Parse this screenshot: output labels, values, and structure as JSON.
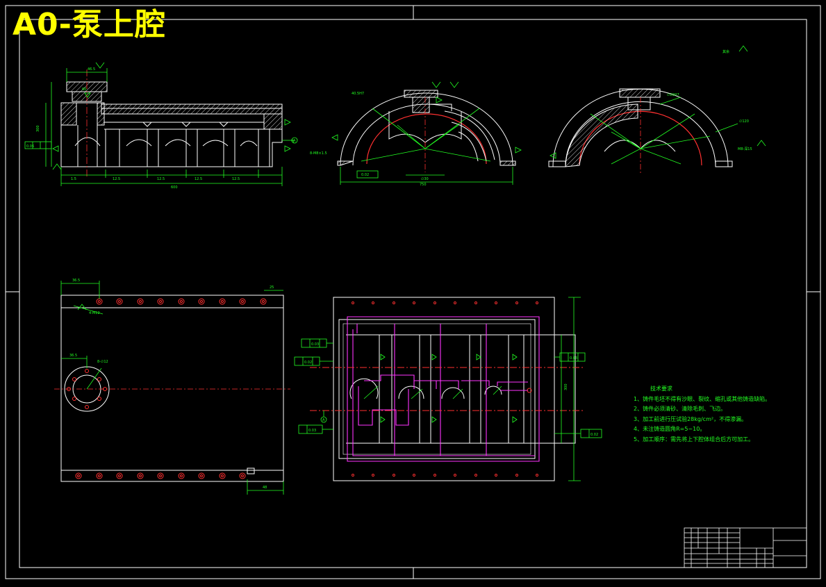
{
  "drawing": {
    "title": "A0-泵上腔",
    "colors": {
      "background": "#000000",
      "outline": "#ffffff",
      "dimension": "#22ff22",
      "centerline": "#ff3030",
      "hatch": "#ffffff",
      "pipe": "#ff33ff",
      "title_text": "#ffff00"
    }
  },
  "technical_requirements": {
    "heading": "技术要求",
    "items": [
      "1、铸件毛坯不得有沙眼、裂纹、缩孔或其他铸造缺陷。",
      "2、铸件必须清砂、清除毛刺、飞边。",
      "3、加工前进行压试验28kg/cm²，不得渗漏。",
      "4、未注铸造圆角R=5~10。",
      "5、加工顺序：需先将上下腔体组合后方可加工。"
    ]
  },
  "datum_labels": [
    "A",
    "A",
    "B"
  ]
}
